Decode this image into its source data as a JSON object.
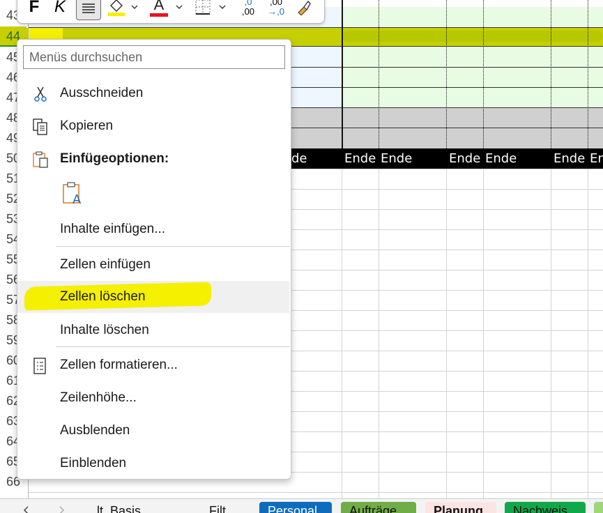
{
  "row_headers": [
    "43",
    "44",
    "45",
    "46",
    "47",
    "48",
    "49",
    "50",
    "51",
    "52",
    "53",
    "54",
    "55",
    "56",
    "57",
    "58",
    "59",
    "60",
    "61",
    "62",
    "63",
    "64",
    "65",
    "66"
  ],
  "ende_cells": [
    "de",
    "Ende",
    "Ende",
    "Ende",
    "Ende",
    "Ende",
    "En"
  ],
  "ribbon": {
    "bold": "F",
    "italic": "K",
    "font_color_letter": "A",
    "increase_decimal_top": ",0",
    "increase_decimal_bottom": ",00",
    "decrease_decimal_top": ",00",
    "decrease_decimal_bottom": "→,0"
  },
  "menu": {
    "search_placeholder": "Menüs durchsuchen",
    "cut": "Ausschneiden",
    "copy": "Kopieren",
    "paste_options": "Einfügeoptionen:",
    "paste_special": "Inhalte einfügen...",
    "insert_cells": "Zellen einfügen",
    "delete_cells": "Zellen löschen",
    "clear_contents": "Inhalte löschen",
    "format_cells": "Zellen formatieren...",
    "row_height": "Zeilenhöhe...",
    "hide": "Ausblenden",
    "unhide": "Einblenden"
  },
  "sheet_tabs": [
    "...lt_Basis",
    "Filt...",
    "Personal",
    "Aufträge",
    "Planung",
    "Nachweis"
  ],
  "colors": {
    "highlight": "#f5ef00",
    "selected_row": "#c6d000",
    "green_cells": "#e8fbe3",
    "blue_cells": "#eef6ff",
    "gray_rows": "#d0d0d0"
  }
}
